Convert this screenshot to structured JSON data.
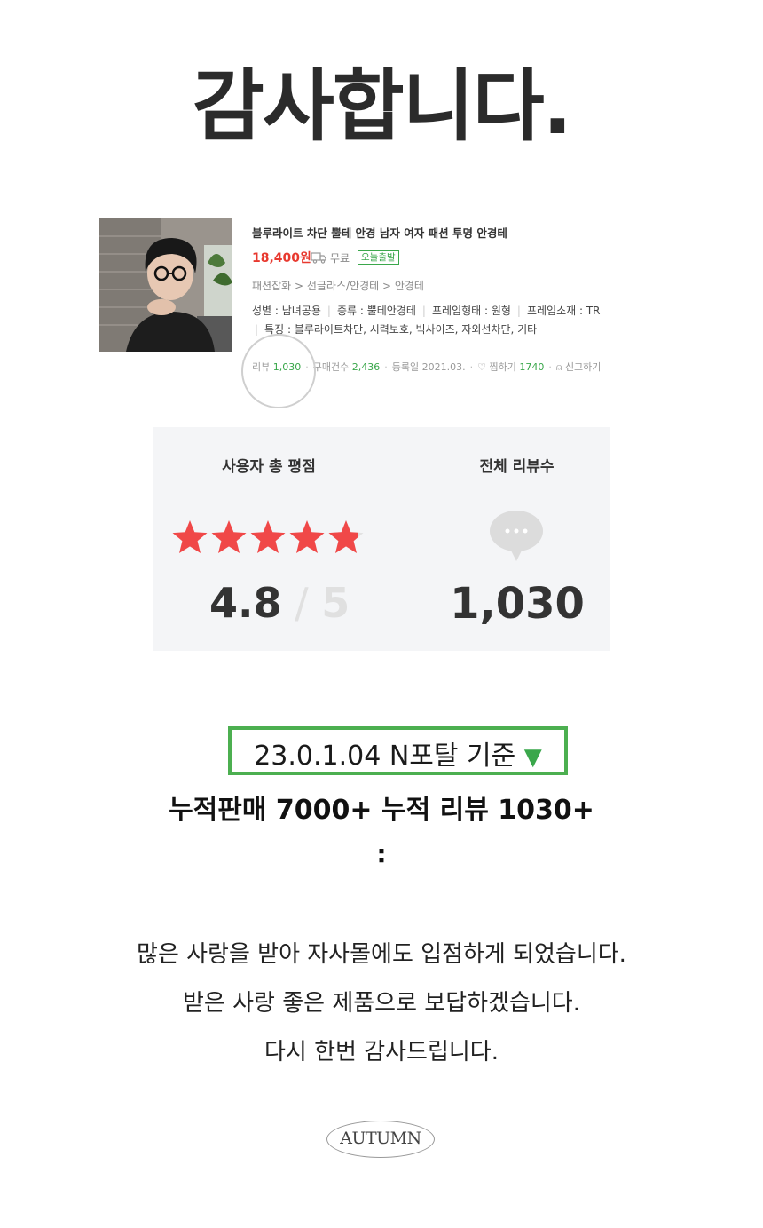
{
  "heading": "감사합니다.",
  "product": {
    "name": "블루라이트 차단 뿔테 안경 남자 여자 패션 투명 안경테",
    "price": "18,400원",
    "shipping": "무료",
    "badge": "오늘출발",
    "category": "패션잡화 > 선글라스/안경테 > 안경테",
    "specs": [
      "성별 : 남녀공용",
      "종류 : 뿔테안경테",
      "프레임형태 : 원형",
      "프레임소재 : TR"
    ],
    "features": "특징 : 블루라이트차단, 시력보호, 빅사이즈, 자외선차단, 기타",
    "stats": {
      "review_label": "리뷰",
      "review_count": "1,030",
      "purchase_label": "구매건수",
      "purchase_count": "2,436",
      "registered": "등록일 2021.03.",
      "wish_label": "찜하기",
      "wish_count": "1740",
      "report_label": "신고하기"
    },
    "icons": [
      "truck-icon",
      "heart-icon",
      "siren-icon"
    ]
  },
  "rating": {
    "label": "사용자 총 평점",
    "score": "4.8",
    "max": "5",
    "stars_value": 4.8,
    "review_label": "전체 리뷰수",
    "review_total": "1,030",
    "star_color": "#f04848",
    "icons": [
      "star-icon",
      "chat-bubble-icon"
    ]
  },
  "portal": {
    "text": "23.0.1.04 N포탈 기준",
    "arrow": "▼",
    "border_color": "#4caf50"
  },
  "accumulated": "누적판매 7000+ 누적 리뷰 1030+",
  "colon": ":",
  "messages": [
    "많은 사랑을 받아 자사몰에도 입점하게 되었습니다.",
    "받은 사랑 좋은 제품으로 보답하겠습니다.",
    "다시 한번 감사드립니다."
  ],
  "brand": "AUTUMN"
}
